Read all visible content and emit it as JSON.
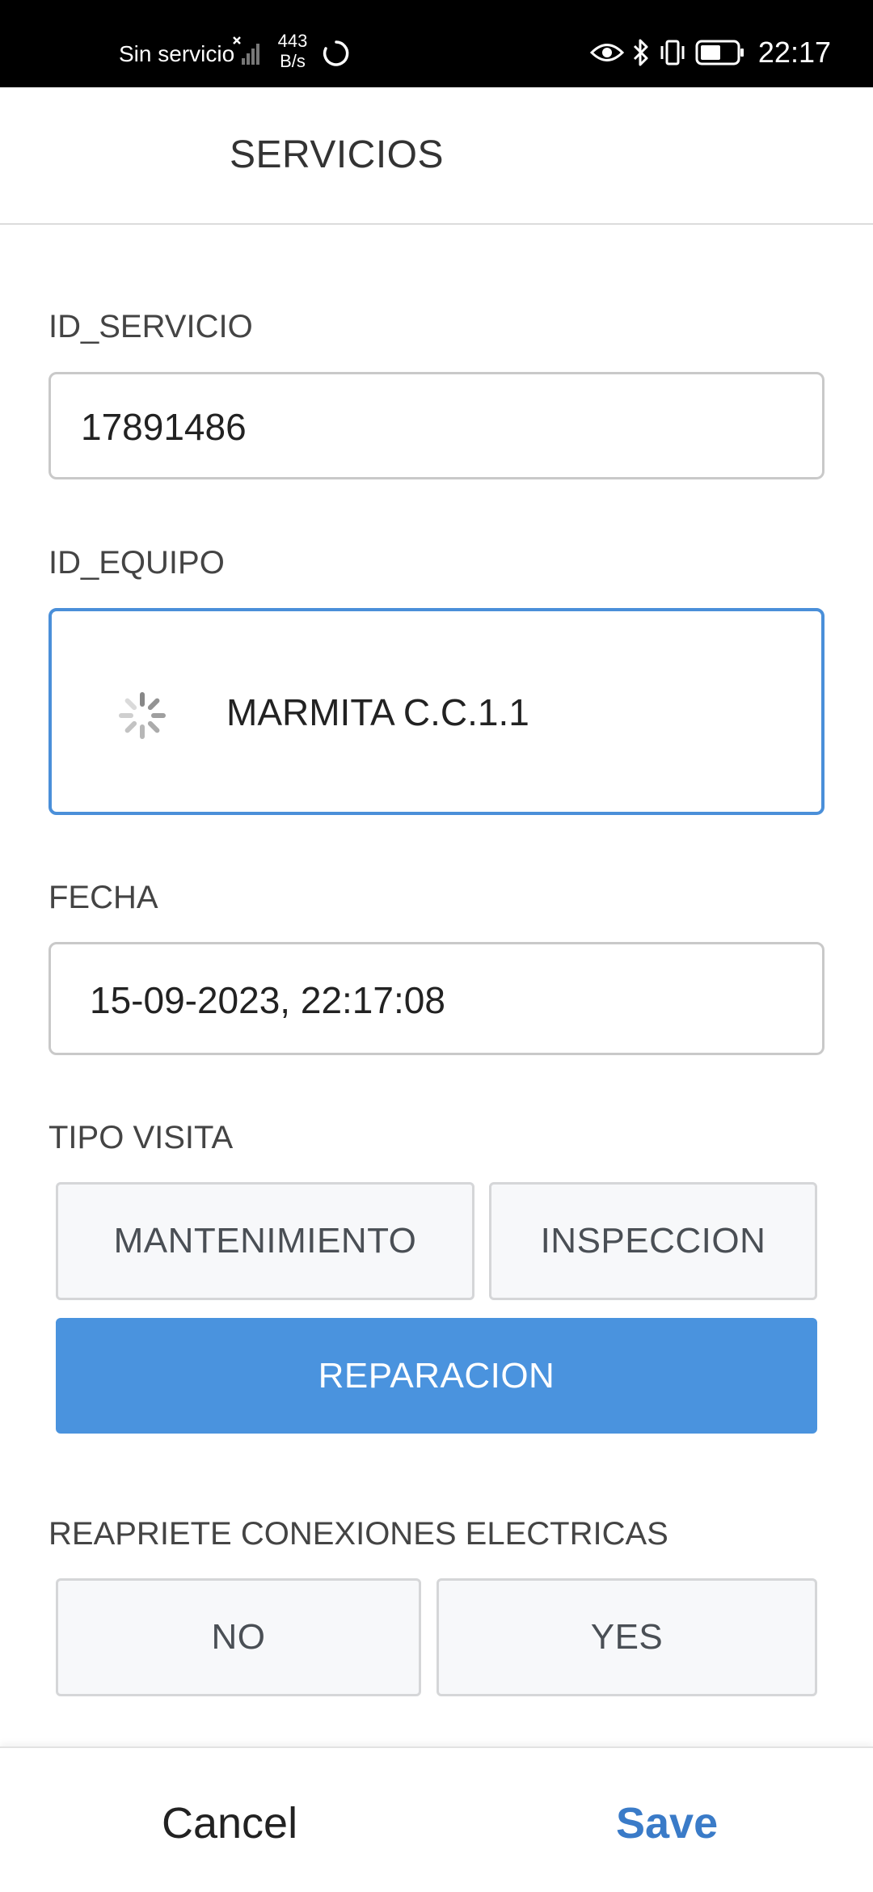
{
  "status_bar": {
    "carrier": "Sin servicio",
    "speed_value": "443",
    "speed_unit": "B/s",
    "time": "22:17",
    "icons": [
      "signal-no-service-icon",
      "sync-icon",
      "eye-icon",
      "bluetooth-icon",
      "vibrate-icon",
      "battery-icon"
    ]
  },
  "header": {
    "title": "SERVICIOS"
  },
  "form": {
    "id_servicio": {
      "label": "ID_SERVICIO",
      "value": "17891486"
    },
    "id_equipo": {
      "label": "ID_EQUIPO",
      "value": "MARMITA C.C.1.1",
      "loading": true
    },
    "fecha": {
      "label": "FECHA",
      "value": "15-09-2023, 22:17:08"
    },
    "tipo_visita": {
      "label": "TIPO VISITA",
      "options": [
        "MANTENIMIENTO",
        "INSPECCION",
        "REPARACION"
      ],
      "selected": "REPARACION"
    },
    "reapriete": {
      "label": "REAPRIETE CONEXIONES ELECTRICAS",
      "options": [
        "NO",
        "YES"
      ],
      "selected": null
    }
  },
  "footer": {
    "cancel_label": "Cancel",
    "save_label": "Save"
  },
  "colors": {
    "accent": "#4a93de",
    "save_text": "#3a7bc8",
    "focus_border": "#4a8fd9"
  }
}
